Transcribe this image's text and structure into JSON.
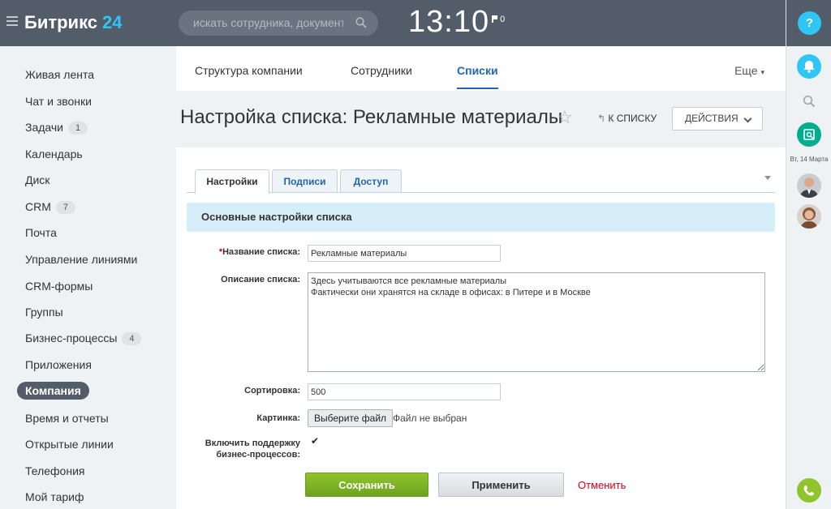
{
  "header": {
    "logo_main": "Битрикс",
    "logo_num": "24",
    "search_placeholder": "искать сотрудника, документ, п",
    "clock": "13:10",
    "flag_count": "0"
  },
  "right_panel": {
    "help": "?",
    "date": "Вт, 14 Марта"
  },
  "sidebar": {
    "items": [
      {
        "label": "Живая лента",
        "badge": ""
      },
      {
        "label": "Чат и звонки",
        "badge": ""
      },
      {
        "label": "Задачи",
        "badge": "1"
      },
      {
        "label": "Календарь",
        "badge": ""
      },
      {
        "label": "Диск",
        "badge": ""
      },
      {
        "label": "CRM",
        "badge": "7"
      },
      {
        "label": "Почта",
        "badge": ""
      },
      {
        "label": "Управление линиями",
        "badge": ""
      },
      {
        "label": "CRM-формы",
        "badge": ""
      },
      {
        "label": "Группы",
        "badge": ""
      },
      {
        "label": "Бизнес-процессы",
        "badge": "4"
      },
      {
        "label": "Приложения",
        "badge": ""
      },
      {
        "label": "Компания",
        "badge": ""
      },
      {
        "label": "Время и отчеты",
        "badge": ""
      },
      {
        "label": "Открытые линии",
        "badge": ""
      },
      {
        "label": "Телефония",
        "badge": ""
      },
      {
        "label": "Мой тариф",
        "badge": ""
      }
    ]
  },
  "topnav": {
    "items": [
      "Структура компании",
      "Сотрудники",
      "Списки"
    ],
    "more": "Еще"
  },
  "page": {
    "title": "Настройка списка: Рекламные материалы",
    "back": "К СПИСКУ",
    "actions": "ДЕЙСТВИЯ"
  },
  "form": {
    "tabs": [
      "Настройки",
      "Подписи",
      "Доступ"
    ],
    "section": "Основные настройки списка",
    "name_label": "Название списка:",
    "name_value": "Рекламные материалы",
    "desc_label": "Описание списка:",
    "desc_value": "Здесь учитываются все рекламные материалы\nФактически они хранятся на складе в офисах: в Питере и в Москве",
    "sort_label": "Сортировка:",
    "sort_value": "500",
    "image_label": "Картинка:",
    "file_button": "Выберите файл",
    "file_status": "Файл не выбран",
    "bp_label_1": "Включить поддержку",
    "bp_label_2": "бизнес-процессов:",
    "bp_checked": true,
    "save": "Сохранить",
    "apply": "Применить",
    "cancel": "Отменить"
  }
}
